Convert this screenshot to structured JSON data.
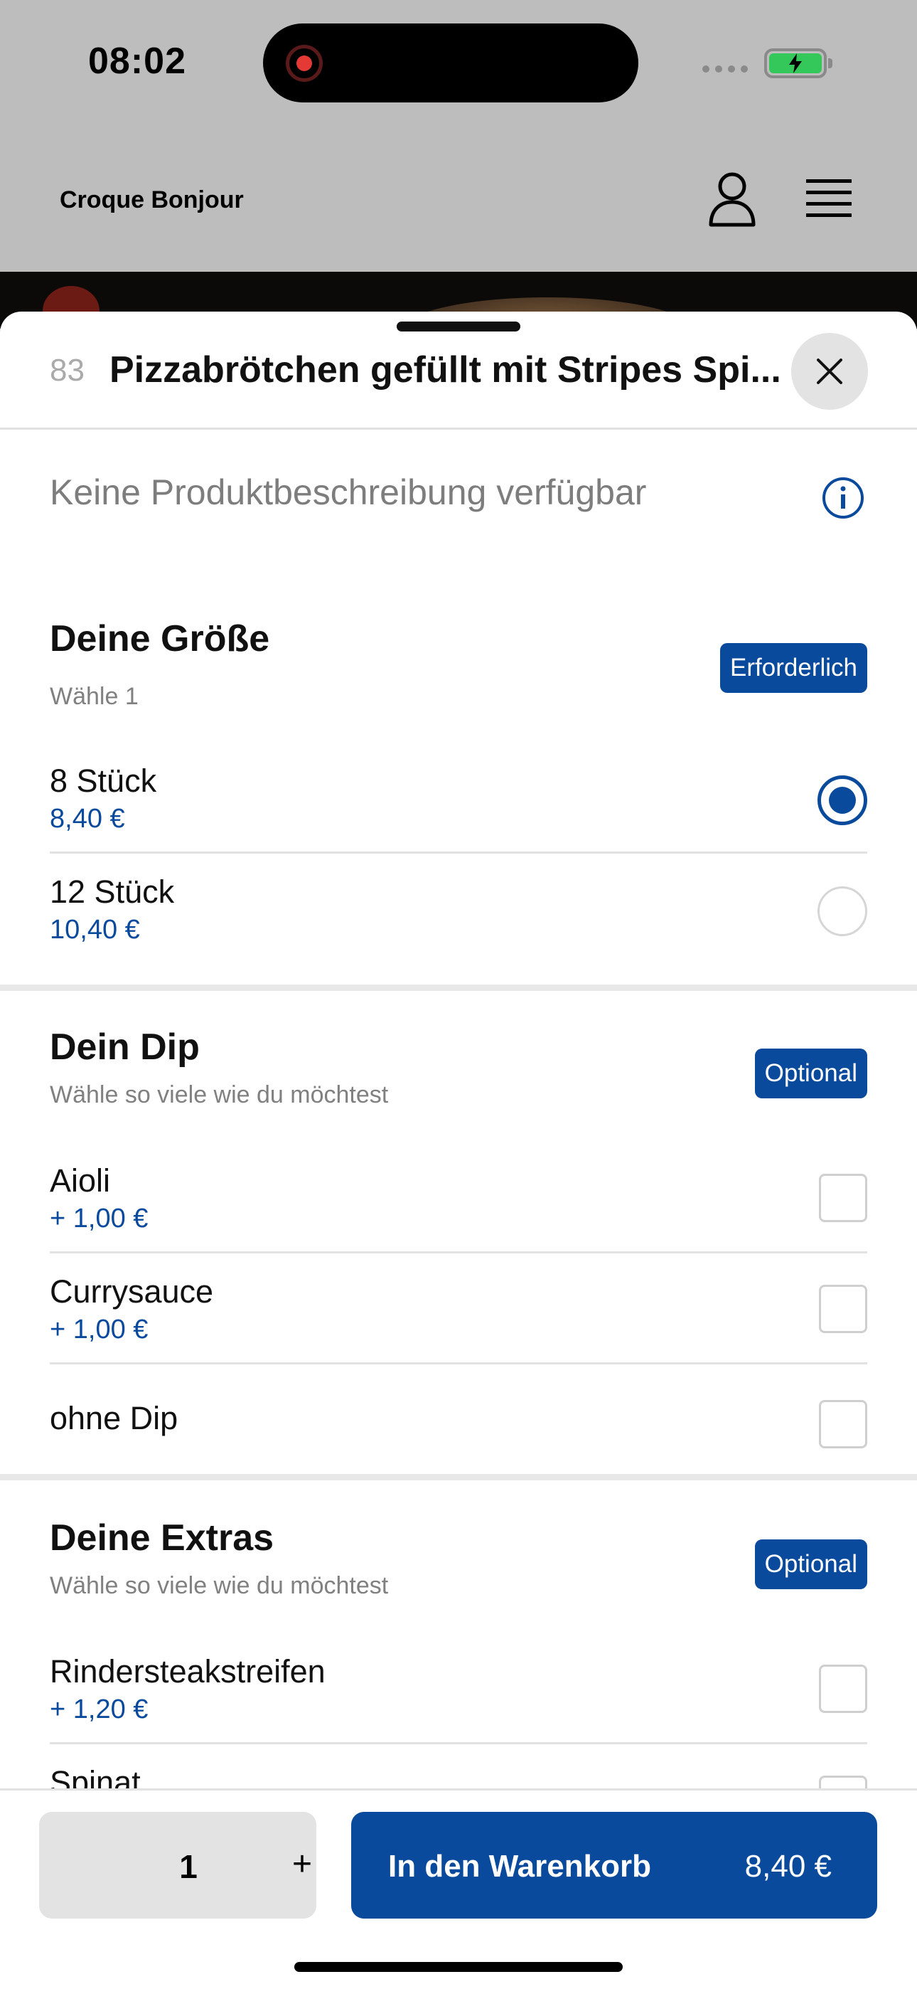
{
  "status": {
    "time": "08:02"
  },
  "header": {
    "brand": "Croque Bonjour"
  },
  "product": {
    "number": "83",
    "title": "Pizzabrötchen gefüllt mit Stripes Spi...",
    "description": "Keine Produktbeschreibung verfügbar"
  },
  "groups": [
    {
      "title": "Deine Größe",
      "subtitle": "Wähle 1",
      "badge": "Erforderlich",
      "options": [
        {
          "name": "8 Stück",
          "price": "8,40 €",
          "selected": true
        },
        {
          "name": "12 Stück",
          "price": "10,40 €",
          "selected": false
        }
      ]
    },
    {
      "title": "Dein Dip",
      "subtitle": "Wähle so viele wie du möchtest",
      "badge": "Optional",
      "options": [
        {
          "name": "Aioli",
          "price": "+ 1,00 €",
          "selected": false
        },
        {
          "name": "Currysauce",
          "price": "+ 1,00 €",
          "selected": false
        },
        {
          "name": "ohne Dip",
          "price": "",
          "selected": false
        }
      ]
    },
    {
      "title": "Deine Extras",
      "subtitle": "Wähle so viele wie du möchtest",
      "badge": "Optional",
      "options": [
        {
          "name": "Rindersteakstreifen",
          "price": "+ 1,20 €",
          "selected": false
        },
        {
          "name": "Spinat",
          "price": "",
          "selected": false
        }
      ]
    }
  ],
  "footer": {
    "quantity": "1",
    "plus": "+",
    "add_to_cart": "In den Warenkorb",
    "total": "8,40 €"
  }
}
